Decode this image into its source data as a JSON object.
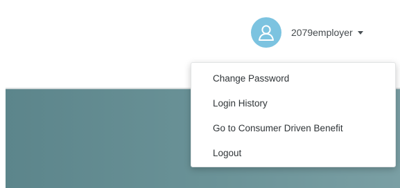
{
  "header": {
    "username": "2079employer",
    "avatar_icon": "user-icon",
    "caret_icon": "caret-down-icon"
  },
  "user_menu": {
    "items": [
      {
        "label": "Change Password"
      },
      {
        "label": "Login History"
      },
      {
        "label": "Go to Consumer Driven Benefit"
      },
      {
        "label": "Logout"
      }
    ]
  },
  "colors": {
    "avatar_bg": "#7cc3e0",
    "banner": "#6b9398"
  }
}
